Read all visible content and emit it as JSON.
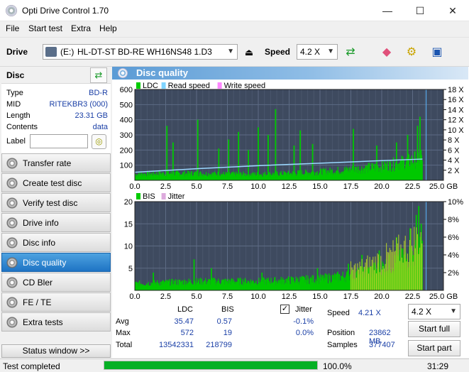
{
  "window": {
    "title": "Opti Drive Control 1.70",
    "minimize": "—",
    "maximize": "☐",
    "close": "✕"
  },
  "menu": [
    "File",
    "Start test",
    "Extra",
    "Help"
  ],
  "toolbar": {
    "drive_label": "Drive",
    "drive_letter": "(E:)",
    "drive_name": "HL-DT-ST BD-RE  WH16NS48 1.D3",
    "speed_label": "Speed",
    "speed_value": "4.2 X"
  },
  "disc": {
    "header": "Disc",
    "fields": [
      {
        "key": "Type",
        "value": "BD-R"
      },
      {
        "key": "MID",
        "value": "RITEKBR3 (000)"
      },
      {
        "key": "Length",
        "value": "23.31 GB"
      },
      {
        "key": "Contents",
        "value": "data"
      },
      {
        "key": "Label",
        "value": ""
      }
    ]
  },
  "nav": [
    {
      "label": "Transfer rate",
      "active": false
    },
    {
      "label": "Create test disc",
      "active": false
    },
    {
      "label": "Verify test disc",
      "active": false
    },
    {
      "label": "Drive info",
      "active": false
    },
    {
      "label": "Disc info",
      "active": false
    },
    {
      "label": "Disc quality",
      "active": true
    },
    {
      "label": "CD Bler",
      "active": false
    },
    {
      "label": "FE / TE",
      "active": false
    },
    {
      "label": "Extra tests",
      "active": false
    }
  ],
  "status_window_button": "Status window >>",
  "panel_title": "Disc quality",
  "chart_data": [
    {
      "type": "area",
      "legend": [
        "LDC",
        "Read speed",
        "Write speed"
      ],
      "colors": {
        "LDC": "#00cc00",
        "Read speed": "#7fd4ff",
        "Write speed": "#ff88ff"
      },
      "x_ticks": [
        "0.0",
        "2.5",
        "5.0",
        "7.5",
        "10.0",
        "12.5",
        "15.0",
        "17.5",
        "20.0",
        "22.5",
        "25.0 GB"
      ],
      "xlim": [
        0,
        25
      ],
      "y_ticks": [
        "100",
        "200",
        "300",
        "400",
        "500",
        "600"
      ],
      "ylim": [
        0,
        600
      ],
      "y2_ticks": [
        "2 X",
        "4 X",
        "6 X",
        "8 X",
        "10 X",
        "12 X",
        "14 X",
        "16 X",
        "18 X"
      ],
      "y2lim": [
        0,
        18
      ],
      "ldc_baseline": [
        [
          0,
          40
        ],
        [
          2.5,
          45
        ],
        [
          5,
          45
        ],
        [
          7.5,
          40
        ],
        [
          10,
          40
        ],
        [
          12.5,
          45
        ],
        [
          15,
          55
        ],
        [
          17.5,
          70
        ],
        [
          20,
          90
        ],
        [
          22.5,
          130
        ],
        [
          23.3,
          160
        ]
      ],
      "ldc_spikes": [
        [
          2.6,
          360
        ],
        [
          3.1,
          250
        ],
        [
          5.1,
          400
        ],
        [
          6.8,
          210
        ],
        [
          7.6,
          270
        ],
        [
          8.4,
          320
        ],
        [
          9.2,
          200
        ],
        [
          10.0,
          350
        ],
        [
          10.8,
          300
        ],
        [
          11.4,
          470
        ],
        [
          12.9,
          230
        ],
        [
          13.4,
          330
        ],
        [
          14.4,
          240
        ],
        [
          17.7,
          340
        ],
        [
          19.6,
          230
        ],
        [
          21.2,
          250
        ],
        [
          22.1,
          300
        ],
        [
          22.9,
          360
        ],
        [
          23.1,
          420
        ]
      ],
      "read_speed": [
        [
          0,
          1.6
        ],
        [
          5,
          2.3
        ],
        [
          10,
          2.9
        ],
        [
          15,
          3.4
        ],
        [
          20,
          3.9
        ],
        [
          23.3,
          4.21
        ]
      ],
      "cursor_x": 23.6
    },
    {
      "type": "area",
      "legend": [
        "BIS",
        "Jitter"
      ],
      "colors": {
        "BIS": "#00cc00",
        "Jitter": "#ddaadd"
      },
      "x_ticks": [
        "0.0",
        "2.5",
        "5.0",
        "7.5",
        "10.0",
        "12.5",
        "15.0",
        "17.5",
        "20.0",
        "22.5",
        "25.0 GB"
      ],
      "xlim": [
        0,
        25
      ],
      "y_ticks": [
        "5",
        "10",
        "15",
        "20"
      ],
      "ylim": [
        0,
        20
      ],
      "y2_ticks": [
        "2%",
        "4%",
        "6%",
        "8%",
        "10%"
      ],
      "y2lim": [
        0,
        10
      ],
      "bis_baseline": [
        [
          0,
          1.5
        ],
        [
          5,
          2
        ],
        [
          10,
          2
        ],
        [
          15,
          2.5
        ],
        [
          18,
          3.5
        ],
        [
          20,
          5
        ],
        [
          22,
          7
        ],
        [
          23.3,
          9
        ]
      ],
      "bis_spikes": [
        [
          1.5,
          4
        ],
        [
          4.8,
          7
        ],
        [
          6.2,
          5
        ],
        [
          10.3,
          4
        ],
        [
          14.8,
          5
        ],
        [
          17.3,
          6
        ],
        [
          18.4,
          8
        ],
        [
          19.8,
          9
        ],
        [
          21.2,
          12
        ],
        [
          22.3,
          14
        ],
        [
          22.8,
          17
        ],
        [
          23.0,
          19
        ],
        [
          23.2,
          15
        ]
      ],
      "cursor_x": 23.6
    }
  ],
  "stats": {
    "col_ldc": "LDC",
    "col_bis": "BIS",
    "jitter_label": "Jitter",
    "jitter_checked": true,
    "rows": [
      {
        "label": "Avg",
        "ldc": "35.47",
        "bis": "0.57",
        "jitter": "-0.1%"
      },
      {
        "label": "Max",
        "ldc": "572",
        "bis": "19",
        "jitter": "0.0%"
      },
      {
        "label": "Total",
        "ldc": "13542331",
        "bis": "218799",
        "jitter": ""
      }
    ],
    "speed_label": "Speed",
    "speed_value": "4.21 X",
    "position_label": "Position",
    "position_value": "23862 MB",
    "samples_label": "Samples",
    "samples_value": "377407",
    "speed_combo": "4.2 X",
    "start_full": "Start full",
    "start_part": "Start part"
  },
  "status": {
    "text": "Test completed",
    "progress": 1.0,
    "progress_text": "100.0%",
    "time": "31:29"
  }
}
